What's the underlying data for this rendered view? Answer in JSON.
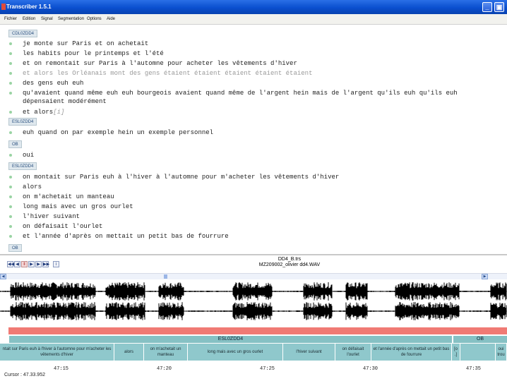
{
  "window": {
    "title": "Transcriber 1.5.1"
  },
  "menu": [
    "Fichier",
    "Edition",
    "Signal",
    "Segmentation",
    "Options",
    "Aide"
  ],
  "transcript": [
    {
      "kind": "speaker",
      "label": "CDL0ZDD4"
    },
    {
      "kind": "utt",
      "text": "je monte sur Paris et on achetait"
    },
    {
      "kind": "utt",
      "text": "les habits pour le printemps et l'été"
    },
    {
      "kind": "utt",
      "text": "et on remontait sur Paris à l'automne pour acheter les vêtements d'hiver"
    },
    {
      "kind": "utt",
      "text": "et alors les Orléanais mont des gens étaient étaient étaient étaient étaient",
      "faded": true
    },
    {
      "kind": "utt",
      "text": "des gens euh euh"
    },
    {
      "kind": "utt",
      "text": "qu'avaient quand même euh euh bourgeois avaient quand même de l'argent hein mais de l'argent qu'ils euh qu'ils euh dépensaient modérément"
    },
    {
      "kind": "utt",
      "text": "et alors",
      "noise": "[i]"
    },
    {
      "kind": "speaker",
      "label": "ESL0ZDD4"
    },
    {
      "kind": "utt",
      "text": "euh quand on par exemple hein un exemple personnel"
    },
    {
      "kind": "speaker",
      "label": "OB"
    },
    {
      "kind": "utt",
      "text": "oui"
    },
    {
      "kind": "speaker",
      "label": "ESL0ZDD4"
    },
    {
      "kind": "utt",
      "text": "on montait sur Paris euh à l'hiver à l'automne pour m'acheter les vêtements d'hiver"
    },
    {
      "kind": "utt",
      "text": "alors"
    },
    {
      "kind": "utt",
      "text": "on m'achetait un manteau"
    },
    {
      "kind": "utt",
      "text": "long mais avec un gros ourlet"
    },
    {
      "kind": "utt",
      "text": "l'hiver suivant"
    },
    {
      "kind": "utt",
      "text": "on défaisait l'ourlet"
    },
    {
      "kind": "utt",
      "text": "et l'année d'après on mettait un petit bas de fourrure"
    },
    {
      "kind": "speaker",
      "label": "OB"
    }
  ],
  "file": {
    "trs": "DD4_B.trs",
    "wav": "MZ209002_olivier dd4.WAV"
  },
  "speaker_strip": [
    {
      "label": "ESL0ZDD4"
    },
    {
      "label": "OB"
    }
  ],
  "segments": [
    {
      "text": "ntait sur Paris euh à l'hiver à l'automne pour m'acheter les vêtements d'hiver"
    },
    {
      "text": "alors"
    },
    {
      "text": "on m'achetait un manteau"
    },
    {
      "text": "long mais avec un gros ourlet"
    },
    {
      "text": "l'hiver suivant"
    },
    {
      "text": "on défaisait l'ourlet"
    },
    {
      "text": "et l'année d'après on mettait un petit bas de fourrure"
    },
    {
      "text": "[o .]"
    },
    {
      "text": ""
    },
    {
      "text": "oui trou"
    }
  ],
  "time_ticks": [
    "47:15",
    "47:20",
    "47:25",
    "47:30",
    "47:35"
  ],
  "cursor": "Cursor : 47.33.952",
  "colors": {
    "title_bar": "#0a4fcf",
    "speaker_tag": "#dfe8ee",
    "bullet": "#9ad4a4",
    "segment": "#8fc8cc",
    "red_band": "#f07a74"
  },
  "icons": [
    "app-icon",
    "minimize-icon",
    "maximize-icon",
    "rewind-fast-icon",
    "rewind-icon",
    "pause-icon",
    "play-icon",
    "forward-icon",
    "forward-fast-icon",
    "info-icon"
  ]
}
